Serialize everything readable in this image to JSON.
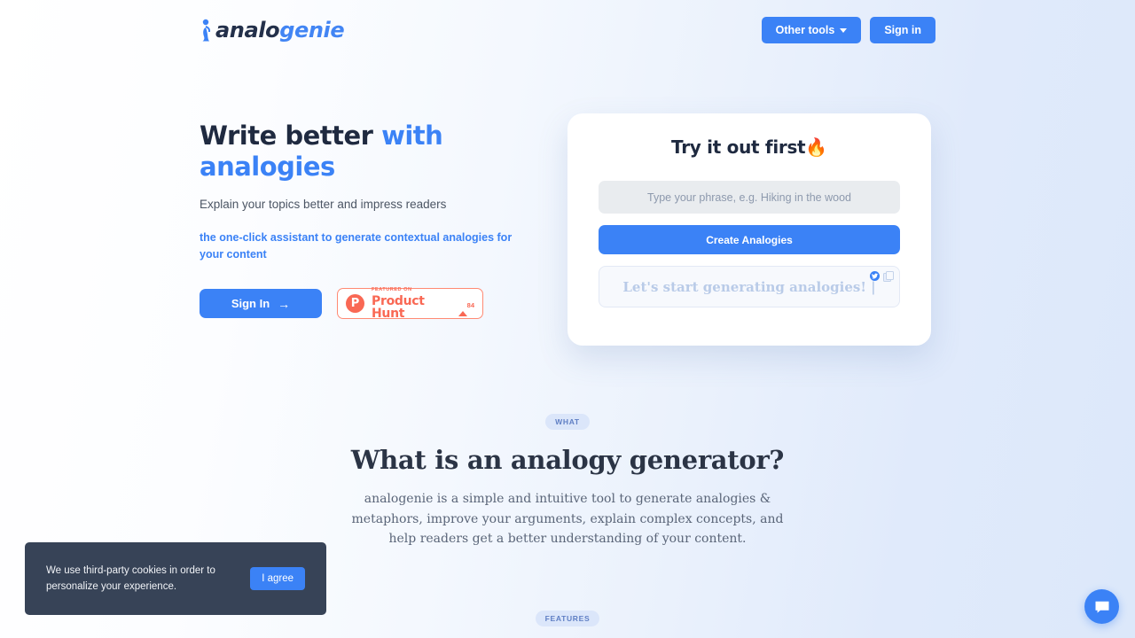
{
  "header": {
    "logo": {
      "icon": "genie-icon",
      "text_dark": "analo",
      "text_blue": "genie"
    },
    "other_tools_label": "Other tools",
    "sign_in_label": "Sign in"
  },
  "hero": {
    "title_plain": "Write better ",
    "title_accent": "with analogies",
    "subtitle": "Explain your topics better and impress readers",
    "tagline": "the one-click assistant to generate contextual analogies for your content",
    "sign_in_button": "Sign In",
    "sign_in_arrow": "→",
    "product_hunt": {
      "featured_label": "FEATURED ON",
      "name": "Product Hunt",
      "upvotes": "84",
      "logo_letter": "P"
    }
  },
  "card": {
    "title": "Try it out first🔥",
    "input_placeholder": "Type your phrase, e.g. Hiking in the wood",
    "input_value": "",
    "create_button": "Create Analogies",
    "output_text": "Let's start generating analogies! |",
    "twitter_icon": "twitter-icon",
    "copy_icon": "copy-icon"
  },
  "what_section": {
    "badge": "WHAT",
    "title": "What is an analogy generator?",
    "body": "analogenie is a simple and intuitive tool to generate analogies & metaphors, improve your arguments, explain complex concepts, and help readers get a better understanding of your content."
  },
  "features_section": {
    "badge": "FEATURES"
  },
  "cookie_banner": {
    "message": "We use third-party cookies in order to personalize your experience.",
    "agree_label": "I agree"
  },
  "chat": {
    "icon": "chat-bubble-icon"
  },
  "colors": {
    "accent_blue": "#3b82f6",
    "logo_dark": "#23304a",
    "product_hunt_orange": "#f96854",
    "cookie_dark": "#374357",
    "pill_bg": "#dbe6fa"
  }
}
